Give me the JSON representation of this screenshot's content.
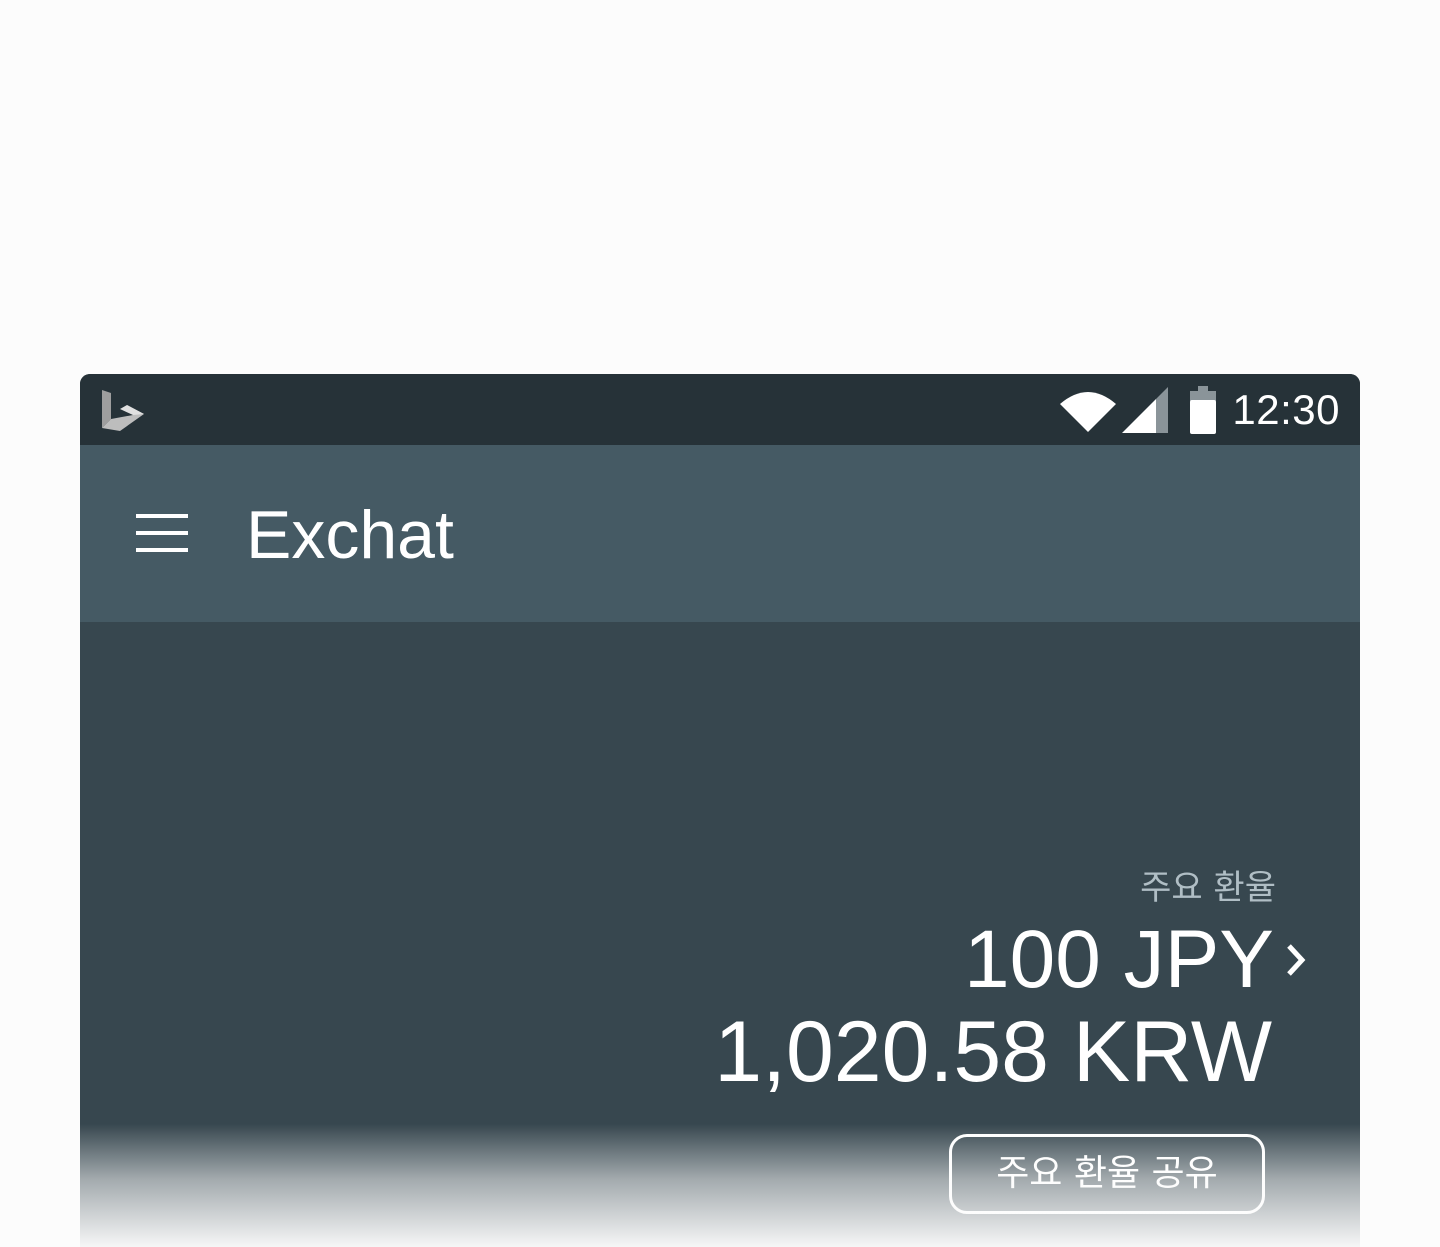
{
  "status_bar": {
    "time": "12:30",
    "icons": [
      "bing-logo-icon",
      "wifi-icon",
      "cell-signal-icon",
      "battery-icon"
    ]
  },
  "toolbar": {
    "title": "Exchat",
    "menu_icon": "hamburger-menu-icon"
  },
  "exchange": {
    "label": "주요 환율",
    "from_amount": "100 JPY",
    "to_amount": "1,020.58 KRW",
    "share_label": "주요 환율 공유"
  },
  "colors": {
    "status_bar": "#263238",
    "toolbar": "#455a64",
    "content": "#37474f",
    "label_text": "#b0bec5",
    "text": "#ffffff"
  }
}
